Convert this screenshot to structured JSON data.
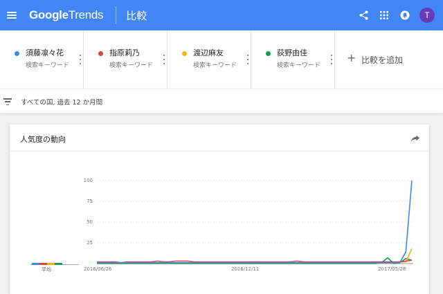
{
  "header": {
    "logo_google": "Google",
    "logo_trends": "Trends",
    "title": "比較",
    "avatar_initial": "T",
    "icons": [
      "menu-icon",
      "share-icon",
      "apps-grid-icon",
      "notifications-icon"
    ],
    "brand_color": "#4285f4",
    "avatar_color": "#673ab7"
  },
  "terms": [
    {
      "name": "須藤凛々花",
      "sub": "検索キーワード",
      "color": "#4285f4"
    },
    {
      "name": "指原莉乃",
      "sub": "検索キーワード",
      "color": "#db4437"
    },
    {
      "name": "渡辺麻友",
      "sub": "検索キーワード",
      "color": "#f4b400"
    },
    {
      "name": "荻野由佳",
      "sub": "検索キーワード",
      "color": "#0f9d58"
    }
  ],
  "add_compare": {
    "plus": "+",
    "label": "比較を追加"
  },
  "filter": {
    "text": "すべての国, 過去 12 か月間"
  },
  "card": {
    "title": "人気度の動向"
  },
  "averages": {
    "label": "平均",
    "values": [
      2,
      2,
      1,
      1
    ]
  },
  "chart_data": {
    "type": "line",
    "title": "",
    "xlabel": "",
    "ylabel": "",
    "ylim": [
      0,
      100
    ],
    "yticks": [
      "100",
      "75",
      "50",
      "25"
    ],
    "xticks": [
      "2016/06/26",
      "2016/12/11",
      "2017/05/28"
    ],
    "series": [
      {
        "name": "須藤凛々花",
        "color": "#4285f4",
        "values": [
          1,
          1,
          1,
          1,
          1,
          1,
          1,
          1,
          1,
          1,
          1,
          1,
          1,
          1,
          1,
          1,
          1,
          1,
          1,
          1,
          1,
          1,
          1,
          1,
          1,
          1,
          1,
          1,
          1,
          1,
          1,
          1,
          1,
          1,
          1,
          1,
          1,
          1,
          1,
          1,
          1,
          1,
          1,
          1,
          1,
          1,
          1,
          1,
          1,
          1,
          1,
          14,
          100
        ]
      },
      {
        "name": "指原莉乃",
        "color": "#db4437",
        "values": [
          2,
          2,
          2,
          2,
          1,
          2,
          2,
          2,
          2,
          2,
          3,
          2,
          2,
          3,
          3,
          3,
          2,
          2,
          2,
          2,
          2,
          2,
          2,
          2,
          2,
          2,
          2,
          2,
          2,
          2,
          2,
          2,
          2,
          3,
          2,
          2,
          2,
          2,
          2,
          2,
          2,
          2,
          2,
          2,
          2,
          2,
          2,
          2,
          2,
          2,
          2,
          3,
          4
        ]
      },
      {
        "name": "渡辺麻友",
        "color": "#f4b400",
        "values": [
          1,
          1,
          1,
          1,
          1,
          1,
          1,
          1,
          1,
          1,
          1,
          1,
          1,
          1,
          1,
          1,
          1,
          1,
          1,
          1,
          1,
          1,
          1,
          1,
          1,
          1,
          2,
          1,
          1,
          1,
          1,
          1,
          1,
          1,
          1,
          1,
          1,
          1,
          1,
          1,
          1,
          1,
          1,
          1,
          1,
          1,
          1,
          1,
          1,
          1,
          2,
          2,
          18
        ]
      },
      {
        "name": "荻野由佳",
        "color": "#0f9d58",
        "values": [
          0,
          0,
          0,
          0,
          0,
          0,
          0,
          0,
          0,
          0,
          0,
          0,
          0,
          0,
          0,
          0,
          0,
          0,
          0,
          0,
          0,
          0,
          0,
          0,
          0,
          0,
          0,
          0,
          0,
          0,
          0,
          0,
          0,
          0,
          0,
          0,
          0,
          0,
          0,
          0,
          0,
          0,
          0,
          0,
          0,
          0,
          0,
          1,
          7,
          0,
          1,
          6,
          4
        ]
      }
    ]
  }
}
